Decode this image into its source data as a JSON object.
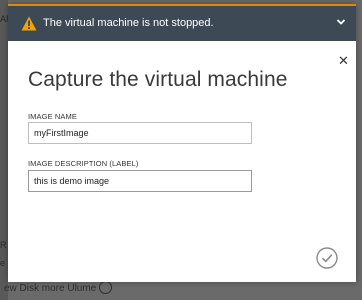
{
  "background": {
    "bottom_text": "ew Disk more Ulume"
  },
  "warning": {
    "text": "The virtual machine is not stopped.",
    "icon": "warning-triangle-icon",
    "accent_color": "#e08a00",
    "bar_color": "#3d4a56"
  },
  "dialog": {
    "title": "Capture the virtual machine",
    "fields": {
      "image_name": {
        "label": "IMAGE NAME",
        "value": "myFirstImage"
      },
      "image_description": {
        "label": "IMAGE DESCRIPTION (LABEL)",
        "value": "this is demo image"
      }
    },
    "close_icon": "close-icon",
    "submit_icon": "checkmark-circle-icon"
  }
}
